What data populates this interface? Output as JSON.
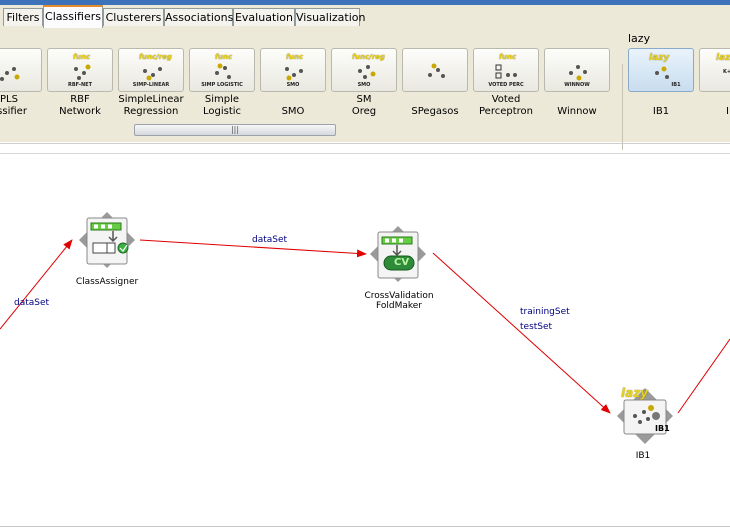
{
  "tabs": [
    "Filters",
    "Classifiers",
    "Clusterers",
    "Associations",
    "Evaluation",
    "Visualization"
  ],
  "active_tab": "Classifiers",
  "toolbar": {
    "tools": [
      {
        "label": "PLS\nassifier",
        "badge": "",
        "tag": ""
      },
      {
        "label": "RBF\nNetwork",
        "badge": "func",
        "tag": "RBF-NET"
      },
      {
        "label": "SimpleLinear\nRegression",
        "badge": "func/reg",
        "tag": "SIMP-LINEAR"
      },
      {
        "label": "Simple\nLogistic",
        "badge": "func",
        "tag": "SIMP LOGISTIC"
      },
      {
        "label": "SMO",
        "badge": "func",
        "tag": "SMO"
      },
      {
        "label": "SM\nOreg",
        "badge": "func/reg",
        "tag": "SMO"
      },
      {
        "label": "SPegasos",
        "badge": "",
        "tag": ""
      },
      {
        "label": "Voted\nPerceptron",
        "badge": "func",
        "tag": "VOTED PERC"
      },
      {
        "label": "Winnow",
        "badge": "",
        "tag": "WINNOW"
      }
    ],
    "lazy_group": {
      "label": "lazy",
      "tools": [
        {
          "label": "IB1",
          "badge": "lazy",
          "tag": "IB1"
        },
        {
          "label": "IB",
          "badge": "lazy",
          "tag": "K+"
        }
      ]
    },
    "scroll_grip": "|||"
  },
  "canvas": {
    "nodes": {
      "class_assigner": "ClassAssigner",
      "cv_foldmaker": "CrossValidation\nFoldMaker",
      "ib1": "IB1",
      "ib1_badge": "lazy",
      "ib1_tag": "IB1",
      "cv_tag": "CV"
    },
    "connections": {
      "left_dataset": "dataSet",
      "dataset": "dataSet",
      "training_set": "trainingSet",
      "test_set": "testSet"
    }
  },
  "colors": {
    "connection": "#e00000",
    "conn_label": "#000080",
    "tab_highlight": "#e68b2c",
    "lazy_badge": "#e7d11c"
  }
}
